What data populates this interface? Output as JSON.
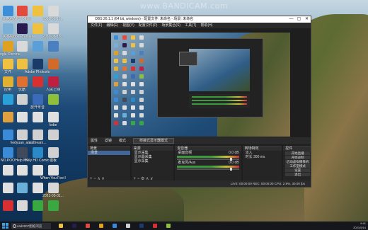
{
  "watermark": "www.BANDICAM.com",
  "desktop_icons": [
    {
      "label": "此电脑",
      "color": "#3c8ed8"
    },
    {
      "label": "WPS Office",
      "color": "#e24b3b"
    },
    {
      "label": "",
      "color": "#f0c040"
    },
    {
      "label": "2021-08-18...",
      "color": "#d9d9d9"
    },
    {
      "label": "回收站",
      "color": "#7ab0d8"
    },
    {
      "label": "Adobe Premiere",
      "color": "#2a1b4e"
    },
    {
      "label": "",
      "color": "#f0c040"
    },
    {
      "label": "2021-08-18...",
      "color": "#d9d9d9"
    },
    {
      "label": "Google Chrome",
      "color": "#e0a020"
    },
    {
      "label": "",
      "color": "#d9d9d9"
    },
    {
      "label": "",
      "color": "#5a9fd8"
    },
    {
      "label": "",
      "color": "#4a7fc0"
    },
    {
      "label": "文件",
      "color": "#f0c040"
    },
    {
      "label": "",
      "color": "#f0c040"
    },
    {
      "label": "Adobe Photoshop",
      "color": "#1a3a6a"
    },
    {
      "label": "",
      "color": "#d46a2a"
    },
    {
      "label": "应用",
      "color": "#e0b030"
    },
    {
      "label": "优酷",
      "color": "#e07030"
    },
    {
      "label": "",
      "color": "#d83030"
    },
    {
      "label": "人民上网",
      "color": "#c02040"
    },
    {
      "label": "",
      "color": "#2aa0d8"
    },
    {
      "label": "",
      "color": "#d0d0d0"
    },
    {
      "label": "放开年音",
      "color": "#3a6ab8"
    },
    {
      "label": "",
      "color": "#8fc03a"
    },
    {
      "label": "",
      "color": "#e0a040"
    },
    {
      "label": "",
      "color": "#e0e0e0"
    },
    {
      "label": "",
      "color": "#e0e0e0"
    },
    {
      "label": "kobe",
      "color": "#e0e0e0"
    },
    {
      "label": "",
      "color": "#3a8ad8"
    },
    {
      "label": "hedyuan_ani...",
      "color": "#d0d0d0"
    },
    {
      "label": "satthearn...",
      "color": "#d0d0d0"
    },
    {
      "label": "",
      "color": "#d0d0d0"
    },
    {
      "label": "NO.POO",
      "color": "#3a8ad8"
    },
    {
      "label": "Help ME",
      "color": "#404a5a"
    },
    {
      "label": "Hely HD Comic Re...",
      "color": "#2a8ac8"
    },
    {
      "label": "模板",
      "color": "#d0d0d0"
    },
    {
      "label": "",
      "color": "#e0e0e0"
    },
    {
      "label": "",
      "color": "#e0e0e0"
    },
    {
      "label": "",
      "color": "#e0e0e0"
    },
    {
      "label": "When You Feel Like",
      "color": "#e0e0e0"
    },
    {
      "label": "",
      "color": "#e0e0e0"
    },
    {
      "label": "",
      "color": "#6ab0d8"
    },
    {
      "label": "",
      "color": "#e0e0e0"
    },
    {
      "label": "2021-05-31...",
      "color": "#d8d8d8"
    },
    {
      "label": "",
      "color": "#d83030"
    },
    {
      "label": "",
      "color": "#d8d8d8"
    },
    {
      "label": "",
      "color": "#38a840"
    },
    {
      "label": "",
      "color": "#38a840"
    }
  ],
  "obs": {
    "title": "OBS 26.1.1 (64 bit, windows) - 配置文件: 未命名 - 场景: 未命名",
    "menu": [
      "文件(F)",
      "编辑(E)",
      "视图(V)",
      "配置文件(P)",
      "场景集合(S)",
      "工具(T)",
      "帮助(H)"
    ],
    "mode_items": [
      "属性",
      "滤镜",
      "模式"
    ],
    "mode_select": "桥接式显示器模式",
    "scenes": {
      "title": "场景",
      "items": [
        "场景"
      ]
    },
    "sources": {
      "title": "来源",
      "items": [
        "显示采集",
        "显示器采集",
        "显示采集"
      ]
    },
    "mixer": {
      "title": "混音器",
      "tracks": [
        "桌面音频",
        "麦克风/Aux"
      ],
      "levels": [
        "0.0 dB",
        "0.0 dB"
      ]
    },
    "transitions": {
      "title": "转场特效",
      "type": "淡入",
      "duration_label": "时长",
      "duration": "300 ms"
    },
    "controls": {
      "title": "控件",
      "buttons": [
        "开始直播",
        "开始录制",
        "启动虚拟摄像机",
        "工作室模式",
        "设置",
        "退出"
      ]
    },
    "status": "LIVE: 00:00:00   REC: 00:00:00   CPU: 2.9%, 30.00 fps"
  },
  "taskbar": {
    "search_text": "cad2007图纸浏览",
    "apps": [
      "#f0c040",
      "#2a1b4e",
      "#e24b3b",
      "#e0a020",
      "#3a8ad8",
      "#d0d0d0",
      "#1a3a6a",
      "#d83030",
      "#8fc03a"
    ],
    "time": "9:41",
    "date": "2021/5/14"
  }
}
